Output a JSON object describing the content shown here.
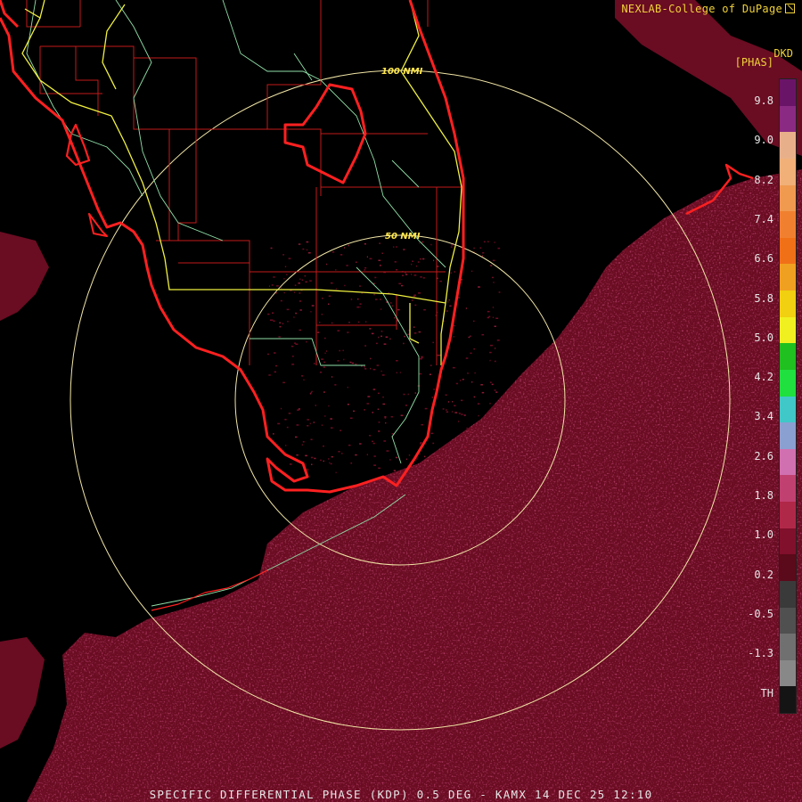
{
  "credit": "NEXLAB-College of DuPage",
  "footer": "SPECIFIC DIFFERENTIAL PHASE (KDP) 0.5 DEG - KAMX 14 DEC 25 12:10",
  "colorbar": {
    "product": "DKD",
    "units": "[PHAS]",
    "labels": [
      "9.8",
      "9.0",
      "8.2",
      "7.4",
      "6.6",
      "5.8",
      "5.0",
      "4.2",
      "3.4",
      "2.6",
      "1.8",
      "1.0",
      "0.2",
      "-0.5",
      "-1.3",
      "TH"
    ],
    "colors": [
      "#6a1468",
      "#8a2a82",
      "#e8b08a",
      "#f0b078",
      "#f09a50",
      "#f08030",
      "#f07018",
      "#f0a020",
      "#f0d010",
      "#f0f020",
      "#20c020",
      "#20e040",
      "#40c8c8",
      "#8aa0d0",
      "#d070b0",
      "#c04070",
      "#b02848",
      "#80102c",
      "#5a0a1a",
      "#3a3a3a",
      "#505050",
      "#707070",
      "#888888",
      "#141414"
    ]
  },
  "rings": {
    "inner": "50 NMI",
    "outer": "100 NMI"
  },
  "colors": {
    "echo": "#6a0c22",
    "echo_bright": "#8a1a34",
    "coast": "#ff2020",
    "county": "#c21a1a",
    "highway": "#f0f040",
    "road": "#90e0a8",
    "ring": "#f2e6a6"
  }
}
